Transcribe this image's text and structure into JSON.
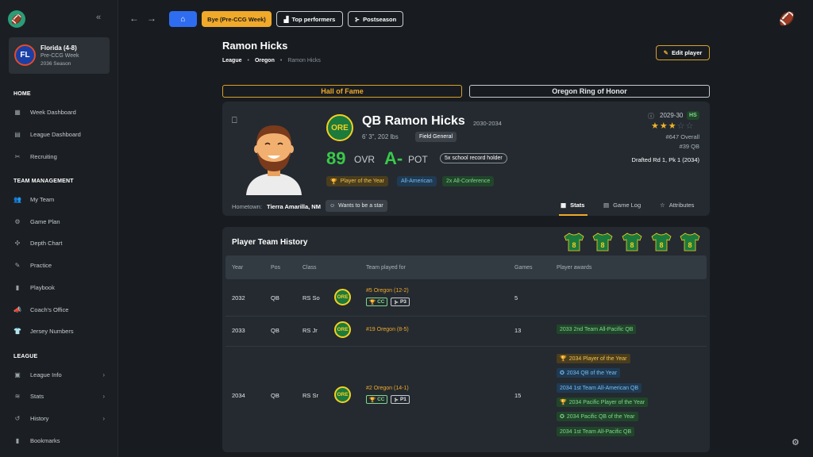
{
  "sidebar": {
    "team_name": "Florida (4-8)",
    "team_week": "Pre-CCG Week",
    "team_season": "2036 Season",
    "team_abbr": "FL",
    "sections": {
      "home": "HOME",
      "team_management": "TEAM MANAGEMENT",
      "league": "LEAGUE"
    },
    "home_items": [
      "Week Dashboard",
      "League Dashboard",
      "Recruiting"
    ],
    "team_items": [
      "My Team",
      "Game Plan",
      "Depth Chart",
      "Practice",
      "Playbook",
      "Coach's Office",
      "Jersey Numbers"
    ],
    "league_items": [
      "League Info",
      "Stats",
      "History",
      "Bookmarks"
    ]
  },
  "topbar": {
    "bye": "Bye (Pre-CCG Week)",
    "top_performers": "Top performers",
    "postseason": "Postseason"
  },
  "page": {
    "title": "Ramon Hicks",
    "breadcrumb": [
      "League",
      "Oregon",
      "Ramon Hicks"
    ],
    "edit_button": "Edit player",
    "hall_of_fame": "Hall of Fame",
    "ring_of_honor": "Oregon Ring of Honor"
  },
  "player": {
    "team_abbr": "ORE",
    "name": "QB Ramon Hicks",
    "years": "2030-2034",
    "measurements": "6' 3\", 202 lbs",
    "archetype": "Field General",
    "ovr": "89",
    "ovr_label": "OVR",
    "pot": "A-",
    "pot_label": "POT",
    "record_badge": "5x school record holder",
    "badges": [
      "Player of the Year",
      "All-American",
      "2x All-Conference"
    ],
    "class_years": "2029-30",
    "hs_tag": "HS",
    "stars": 3,
    "overall_rank": "#647 Overall",
    "pos_rank": "#39 QB",
    "drafted": "Drafted Rd 1, Pk 1 (2034)",
    "hometown_label": "Hometown:",
    "hometown": "Tierra Amarilla, NM",
    "trait": "Wants to be a star",
    "tabs": [
      "Stats",
      "Game Log",
      "Attributes"
    ]
  },
  "history": {
    "title": "Player Team History",
    "jersey_number": "8",
    "headers": [
      "Year",
      "Pos",
      "Class",
      "Team played for",
      "Games",
      "Player awards"
    ],
    "rows": [
      {
        "year": "2032",
        "pos": "QB",
        "class": "RS So",
        "team": "ORE",
        "team_label": "#5 Oregon (12-2)",
        "tags": [
          "CC",
          "P3"
        ],
        "games": "5",
        "awards": []
      },
      {
        "year": "2033",
        "pos": "QB",
        "class": "RS Jr",
        "team": "ORE",
        "team_label": "#19 Oregon (8-5)",
        "tags": [],
        "games": "13",
        "awards": [
          "2033 2nd Team All-Pacific QB"
        ]
      },
      {
        "year": "2034",
        "pos": "QB",
        "class": "RS Sr",
        "team": "ORE",
        "team_label": "#2 Oregon (14-1)",
        "tags": [
          "CC",
          "P1"
        ],
        "games": "15",
        "awards": [
          "2034 Player of the Year",
          "2034 QB of the Year",
          "2034 1st Team All-American QB",
          "2034 Pacific Player of the Year",
          "2034 Pacific QB of the Year",
          "2034 1st Team All-Pacific QB"
        ]
      }
    ]
  },
  "colors": {
    "accent": "#2f6df0",
    "bye": "#f0a92a",
    "ovr": "#39c94a",
    "panel": "#242a30",
    "bg": "#181c20"
  }
}
